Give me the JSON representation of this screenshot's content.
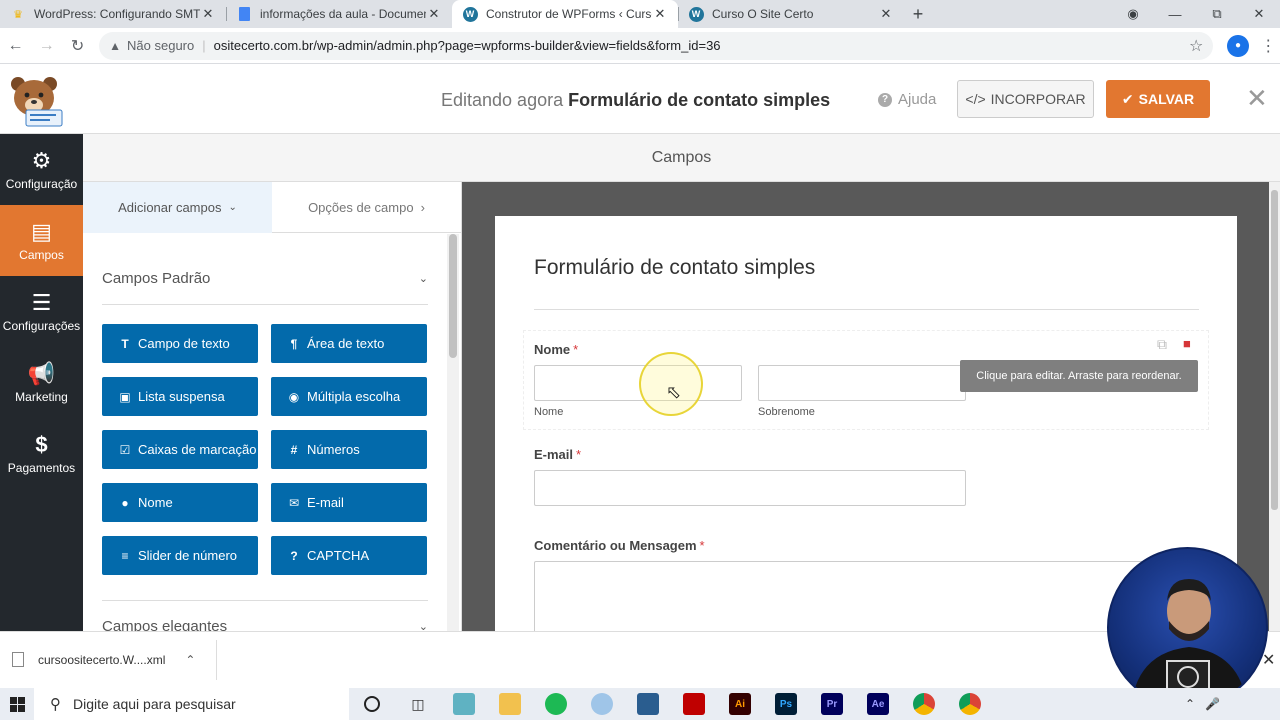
{
  "browser": {
    "tabs": [
      {
        "title": "WordPress: Configurando SMTP",
        "favicon": "smtp-icon",
        "active": false
      },
      {
        "title": "informações da aula - Document",
        "favicon": "docs-icon",
        "active": false
      },
      {
        "title": "Construtor de WPForms ‹ Curso",
        "favicon": "wordpress-icon",
        "active": true
      },
      {
        "title": "Curso O Site Certo",
        "favicon": "wordpress-icon",
        "active": false
      }
    ],
    "security_label": "Não seguro",
    "url": "ositecerto.com.br/wp-admin/admin.php?page=wpforms-builder&view=fields&form_id=36"
  },
  "header": {
    "editing_prefix": "Editando agora",
    "form_name": "Formulário de contato simples",
    "help_label": "Ajuda",
    "embed_label": "INCORPORAR",
    "save_label": "SALVAR"
  },
  "sidebar": {
    "items": [
      {
        "label": "Configuração",
        "icon": "gear-icon",
        "active": false
      },
      {
        "label": "Campos",
        "icon": "list-icon",
        "active": true
      },
      {
        "label": "Configurações",
        "icon": "sliders-icon",
        "active": false
      },
      {
        "label": "Marketing",
        "icon": "megaphone-icon",
        "active": false
      },
      {
        "label": "Pagamentos",
        "icon": "dollar-icon",
        "active": false
      }
    ]
  },
  "section_title": "Campos",
  "panel": {
    "tabs": [
      {
        "label": "Adicionar campos",
        "active": true
      },
      {
        "label": "Opções de campo",
        "active": false
      }
    ],
    "group_standard": "Campos Padrão",
    "fields": [
      {
        "label": "Campo de texto",
        "icon": "text-icon"
      },
      {
        "label": "Área de texto",
        "icon": "paragraph-icon"
      },
      {
        "label": "Lista suspensa",
        "icon": "dropdown-icon"
      },
      {
        "label": "Múltipla escolha",
        "icon": "radio-icon"
      },
      {
        "label": "Caixas de marcação",
        "icon": "checkbox-icon"
      },
      {
        "label": "Números",
        "icon": "hash-icon"
      },
      {
        "label": "Nome",
        "icon": "user-icon"
      },
      {
        "label": "E-mail",
        "icon": "envelope-icon"
      },
      {
        "label": "Slider de número",
        "icon": "slider-icon"
      },
      {
        "label": "CAPTCHA",
        "icon": "question-icon"
      }
    ],
    "group_fancy": "Campos elegantes"
  },
  "preview": {
    "form_title": "Formulário de contato simples",
    "name_label": "Nome",
    "first_sublabel": "Nome",
    "last_sublabel": "Sobrenome",
    "email_label": "E-mail",
    "message_label": "Comentário ou Mensagem",
    "required_mark": "*",
    "tooltip": "Clique para editar. Arraste para reordenar."
  },
  "download": {
    "filename": "cursoositecerto.W....xml"
  },
  "taskbar": {
    "search_placeholder": "Digite aqui para pesquisar"
  },
  "colors": {
    "accent_orange": "#e27730",
    "field_button_blue": "#036aab",
    "sidebar_dark": "#23282d",
    "preview_gray": "#595959"
  }
}
